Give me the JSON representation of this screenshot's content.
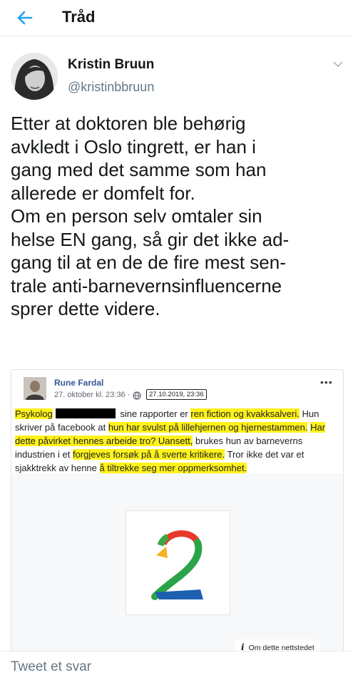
{
  "header": {
    "title": "Tråd"
  },
  "author": {
    "name": "Kristin Bruun",
    "handle": "@kristinbbruun"
  },
  "tweet": {
    "text": "Etter at doktoren ble behørig\navkledt i Oslo tingrett, er han i\ngang med det samme som han\nallerede er domfelt for.\nOm en person selv omtaler sin\nhelse EN gang, så gir det ikke ad-\ngang til at en de de fire mest sen-\ntrale anti-barnevernsinfluencerne\nsprer dette videre."
  },
  "embedded_post": {
    "name": "Rune Fardal",
    "date": "27. oktober kl. 23:36 ·",
    "stamp": "27.10.2019, 23:36",
    "more": "•••",
    "text": {
      "p1": "Psykolog",
      "p2": "sine rapporter er",
      "p3": "ren fiction og kvakksalveri.",
      "p4": "Hun skriver på facebook at",
      "p5": "hun har svulst på lillehjernen og hjernestammen.",
      "p6": "Har dette påvirket hennes arbeide tro? Uansett,",
      "p7": "brukes hun av barneverns industrien i et",
      "p8": "forgjeves forsøk på å sverte kritikere.",
      "p9": "Tror ikke det var et sjakktrekk av henne",
      "p10": "å tiltrekke seg mer oppmerksomhet."
    },
    "about_site": "Om dette nettstedet",
    "about_icon": "i"
  },
  "reply": {
    "placeholder": "Tweet et svar"
  },
  "colors": {
    "accent": "#1da1f2",
    "highlight": "#fff21a",
    "muted": "#657786"
  }
}
